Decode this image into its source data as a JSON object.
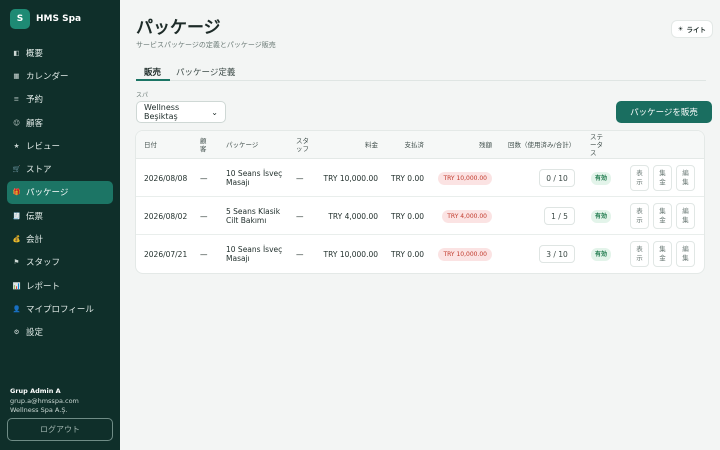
{
  "app": {
    "logo_letter": "S",
    "name": "HMS Spa"
  },
  "sidebar": {
    "items": [
      {
        "icon": "◧",
        "label": "概要"
      },
      {
        "icon": "▦",
        "label": "カレンダー"
      },
      {
        "icon": "≡",
        "label": "予約"
      },
      {
        "icon": "☺",
        "label": "顧客"
      },
      {
        "icon": "★",
        "label": "レビュー"
      },
      {
        "icon": "🛒",
        "label": "ストア"
      },
      {
        "icon": "🎁",
        "label": "パッケージ"
      },
      {
        "icon": "🧾",
        "label": "伝票"
      },
      {
        "icon": "💰",
        "label": "会計"
      },
      {
        "icon": "⚑",
        "label": "スタッフ"
      },
      {
        "icon": "📊",
        "label": "レポート"
      },
      {
        "icon": "👤",
        "label": "マイプロフィール"
      },
      {
        "icon": "⚙",
        "label": "設定"
      }
    ],
    "active_index": 6
  },
  "user": {
    "name": "Grup Admin A",
    "email": "grup.a@hmsspa.com",
    "company": "Wellness Spa A.Ş."
  },
  "logout_label": "ログアウト",
  "header": {
    "title": "パッケージ",
    "subtitle": "サービスパッケージの定義とパッケージ販売",
    "theme_icon": "☀",
    "theme_label": "ライト"
  },
  "tabs": [
    {
      "label": "販売"
    },
    {
      "label": "パッケージ定義"
    }
  ],
  "filter": {
    "label": "スパ",
    "selected": "Wellness Beşiktaş",
    "chevron": "⌄"
  },
  "sell_button": "パッケージを販売",
  "table": {
    "headers": {
      "date": "日付",
      "customer": "顧客",
      "package": "パッケージ",
      "staff": "スタッフ",
      "price": "料金",
      "paid": "支払済",
      "balance": "残額",
      "sessions": "回数（使用済み/合計）",
      "status": "ステータス"
    },
    "rows": [
      {
        "date": "2026/08/08",
        "customer": "—",
        "package": "10 Seans İsveç Masajı",
        "staff": "—",
        "price": "TRY 10,000.00",
        "paid": "TRY 0.00",
        "balance": "TRY 10,000.00",
        "sessions": "0 / 10",
        "status": "有効"
      },
      {
        "date": "2026/08/02",
        "customer": "—",
        "package": "5 Seans Klasik Cilt Bakımı",
        "staff": "—",
        "price": "TRY 4,000.00",
        "paid": "TRY 0.00",
        "balance": "TRY 4,000.00",
        "sessions": "1 / 5",
        "status": "有効"
      },
      {
        "date": "2026/07/21",
        "customer": "—",
        "package": "10 Seans İsveç Masajı",
        "staff": "—",
        "price": "TRY 10,000.00",
        "paid": "TRY 0.00",
        "balance": "TRY 10,000.00",
        "sessions": "3 / 10",
        "status": "有効"
      }
    ],
    "actions": {
      "view": "表示",
      "collect": "集金",
      "edit": "編集"
    }
  },
  "colors": {
    "sidebar_bg": "#0f2f2a",
    "accent": "#1c7565",
    "danger": "#c0392b",
    "success": "#1f7a4d"
  }
}
